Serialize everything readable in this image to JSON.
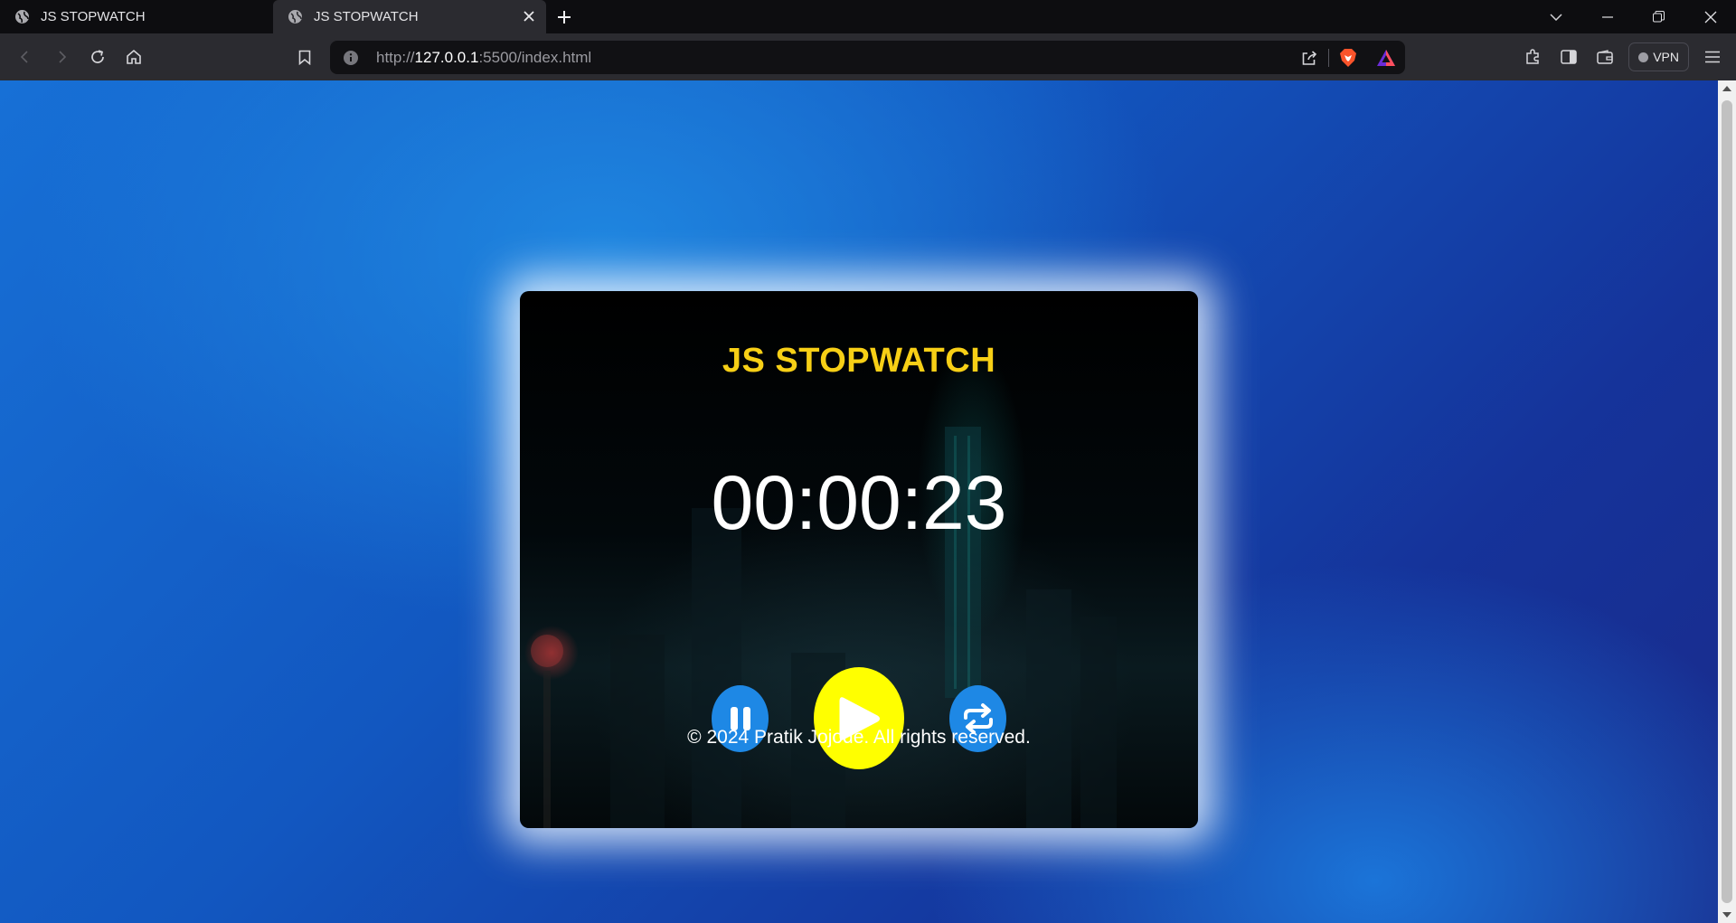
{
  "browser": {
    "tabs": [
      {
        "title": "JS STOPWATCH",
        "active": false
      },
      {
        "title": "JS STOPWATCH",
        "active": true
      }
    ],
    "url": {
      "scheme": "http://",
      "host": "127.0.0.1",
      "rest": ":5500/index.html"
    },
    "vpn_label": "VPN"
  },
  "app": {
    "title": "JS STOPWATCH",
    "time": "00:00:23",
    "copyright": "© 2024 Pratik Jojode. All rights reserved.",
    "colors": {
      "title": "#f7cf16",
      "play_button": "#ffff00",
      "side_buttons": "#1e88e5",
      "background": "#1770d6"
    },
    "buttons": [
      {
        "name": "pause-button",
        "icon": "pause-icon"
      },
      {
        "name": "play-button",
        "icon": "play-icon"
      },
      {
        "name": "reset-button",
        "icon": "repeat-icon"
      }
    ]
  }
}
